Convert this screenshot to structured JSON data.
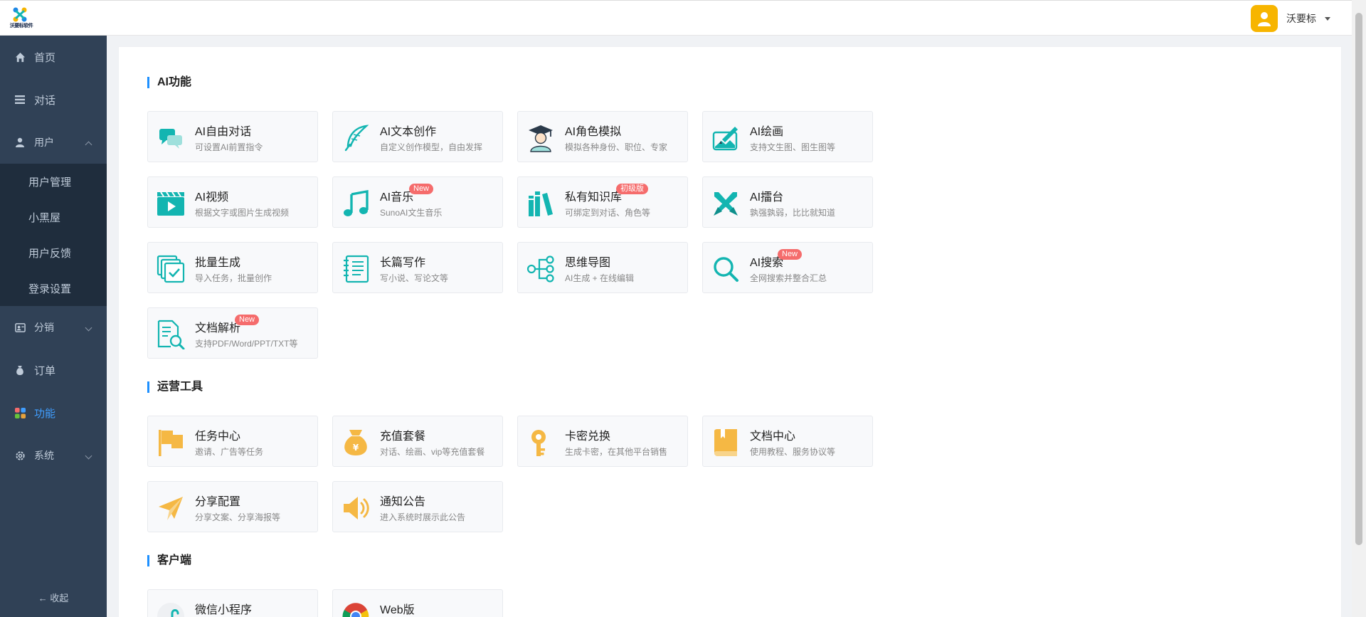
{
  "header": {
    "logo_text": "沃要标软件",
    "user_name": "沃要标"
  },
  "sidebar": {
    "items": [
      {
        "label": "首页",
        "icon": "home-icon"
      },
      {
        "label": "对话",
        "icon": "list-icon"
      },
      {
        "label": "用户",
        "icon": "user-icon",
        "expanded": true
      },
      {
        "label": "分销",
        "icon": "distribution-icon"
      },
      {
        "label": "订单",
        "icon": "money-bag-icon"
      },
      {
        "label": "功能",
        "icon": "grid-icon",
        "active": true
      },
      {
        "label": "系统",
        "icon": "gear-icon"
      }
    ],
    "user_submenu": [
      "用户管理",
      "小黑屋",
      "用户反馈",
      "登录设置"
    ],
    "collapse_label": "← 收起",
    "active_color": "#409eff"
  },
  "sections": [
    {
      "title": "AI功能",
      "cards": [
        {
          "title": "AI自由对话",
          "desc": "可设置AI前置指令",
          "icon": "chat-icon"
        },
        {
          "title": "AI文本创作",
          "desc": "自定义创作模型，自由发挥",
          "icon": "feather-icon"
        },
        {
          "title": "AI角色模拟",
          "desc": "模拟各种身份、职位、专家",
          "icon": "graduate-icon"
        },
        {
          "title": "AI绘画",
          "desc": "支持文生图、图生图等",
          "icon": "painting-icon"
        },
        {
          "title": "AI视频",
          "desc": "根据文字或图片生成视频",
          "icon": "video-icon"
        },
        {
          "title": "AI音乐",
          "desc": "SunoAI文生音乐",
          "icon": "music-icon",
          "badge": "New"
        },
        {
          "title": "私有知识库",
          "desc": "可绑定到对话、角色等",
          "icon": "books-icon",
          "badge": "初级版"
        },
        {
          "title": "AI擂台",
          "desc": "孰强孰弱，比比就知道",
          "icon": "swords-icon"
        },
        {
          "title": "批量生成",
          "desc": "导入任务，批量创作",
          "icon": "batch-icon"
        },
        {
          "title": "长篇写作",
          "desc": "写小说、写论文等",
          "icon": "notebook-icon"
        },
        {
          "title": "思维导图",
          "desc": "AI生成 + 在线编辑",
          "icon": "mindmap-icon"
        },
        {
          "title": "AI搜索",
          "desc": "全网搜索并整合汇总",
          "icon": "search-icon",
          "badge": "New"
        },
        {
          "title": "文档解析",
          "desc": "支持PDF/Word/PPT/TXT等",
          "icon": "document-search-icon",
          "badge": "New"
        }
      ]
    },
    {
      "title": "运营工具",
      "cards": [
        {
          "title": "任务中心",
          "desc": "邀请、广告等任务",
          "icon": "flag-icon"
        },
        {
          "title": "充值套餐",
          "desc": "对话、绘画、vip等充值套餐",
          "icon": "money-bag-icon"
        },
        {
          "title": "卡密兑换",
          "desc": "生成卡密，在其他平台销售",
          "icon": "key-icon"
        },
        {
          "title": "文档中心",
          "desc": "使用教程、服务协议等",
          "icon": "book-icon"
        },
        {
          "title": "分享配置",
          "desc": "分享文案、分享海报等",
          "icon": "paper-plane-icon"
        },
        {
          "title": "通知公告",
          "desc": "进入系统时展示此公告",
          "icon": "speaker-icon"
        }
      ]
    },
    {
      "title": "客户端",
      "cards": [
        {
          "title": "微信小程序",
          "desc": "",
          "icon": "wechat-miniprogram-icon"
        },
        {
          "title": "Web版",
          "desc": "",
          "icon": "chrome-icon"
        }
      ]
    }
  ],
  "colors": {
    "teal_icon": "#13b5b1",
    "orange_icon": "#f5b844",
    "accent": "#1e90ff",
    "badge": "#f56c6c"
  }
}
